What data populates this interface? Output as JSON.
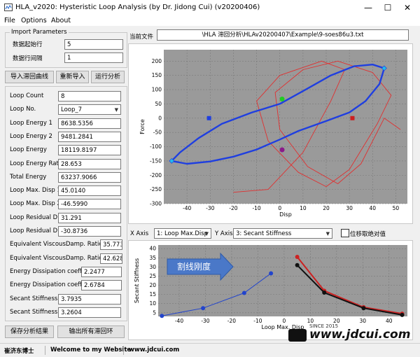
{
  "window": {
    "title": "HLA_v2020: Hysteristic Loop Analysis  (by Dr. Jidong Cui) (v20200406)",
    "minimize": "—",
    "maximize": "☐",
    "close": "✕"
  },
  "menu": {
    "file": "File",
    "options": "Options",
    "about": "About"
  },
  "import": {
    "title": "Import Parameters",
    "start_row_label": "数据起始行",
    "start_row_value": "5",
    "row_interval_label": "数据行间隔",
    "row_interval_value": "1"
  },
  "buttons": {
    "import_loop": "导入滞回曲线",
    "reimport": "重新导入",
    "run_analysis": "运行分析",
    "save_results": "保存分析结果",
    "export_loops": "输出所有滞回环"
  },
  "params": [
    {
      "label": "Loop Count",
      "value": "8"
    },
    {
      "label": "Loop No.",
      "value": "Loop_7"
    },
    {
      "label": "Loop Energy 1",
      "value": "8638.5356"
    },
    {
      "label": "Loop Energy 2",
      "value": "9481.2841"
    },
    {
      "label": "Loop Energy",
      "value": "18119.8197"
    },
    {
      "label": "Loop Energy Ratio (%)",
      "value": "28.653"
    },
    {
      "label": "Total Energy",
      "value": "63237.9066"
    },
    {
      "label": "Loop Max. Disp 1",
      "value": "45.0140"
    },
    {
      "label": "Loop Max. Disp 2",
      "value": "-46.5990"
    },
    {
      "label": "Loop Residual Disp1",
      "value": "31.291"
    },
    {
      "label": "Loop Residual Disp2",
      "value": "-30.8736"
    },
    {
      "label": "Equivalent ViscousDamp. Ratio1 (%)",
      "value": "35.773"
    },
    {
      "label": "Equivalent ViscousDamp. Ratio2 (%)",
      "value": "42.628"
    },
    {
      "label": "Energy Dissipation coeff. 1",
      "value": "2.2477"
    },
    {
      "label": "Energy Dissipation coeff. 2",
      "value": "2.6784"
    },
    {
      "label": "Secant Stiffness 1",
      "value": "3.7935"
    },
    {
      "label": "Secant Stiffness 2",
      "value": "3.2604"
    }
  ],
  "file": {
    "label": "当前文件",
    "path": "\\HLA 滞回分析\\HLAv20200407\\Example\\9-soes86u3.txt"
  },
  "axis_controls": {
    "x_label": "X Axis",
    "x_value": "1: Loop Max.Disp",
    "y_label": "Y Axis",
    "y_value": "3: Secant Stiffness",
    "checkbox_label": "位移取绝对值"
  },
  "chart_data": [
    {
      "type": "line",
      "xlabel": "Disp",
      "ylabel": "Force",
      "xlim": [
        -50,
        55
      ],
      "ylim": [
        -300,
        240
      ],
      "xticks": [
        -40,
        -30,
        -20,
        -10,
        0,
        10,
        20,
        30,
        40,
        50
      ],
      "yticks": [
        -300,
        -250,
        -200,
        -150,
        -100,
        -50,
        0,
        50,
        100,
        150,
        200
      ],
      "grid": true,
      "series": [
        {
          "role": "all loops",
          "color": "#e03030",
          "points": [
            [
              -20,
              -260
            ],
            [
              -5,
              -250
            ],
            [
              10,
              -120
            ],
            [
              22,
              60
            ],
            [
              28,
              170
            ],
            [
              18,
              200
            ],
            [
              0,
              150
            ],
            [
              -10,
              60
            ],
            [
              -5,
              -80
            ],
            [
              8,
              -190
            ],
            [
              20,
              -240
            ],
            [
              30,
              -180
            ],
            [
              42,
              -20
            ],
            [
              48,
              80
            ],
            [
              40,
              160
            ],
            [
              25,
              200
            ],
            [
              10,
              170
            ],
            [
              -2,
              90
            ],
            [
              0,
              -40
            ],
            [
              12,
              -170
            ],
            [
              25,
              -230
            ],
            [
              35,
              -160
            ],
            [
              45,
              0
            ],
            [
              52,
              -40
            ]
          ]
        },
        {
          "role": "selected loop",
          "color": "#1f3fe0",
          "points": [
            [
              -46.6,
              -150
            ],
            [
              -43,
              -120
            ],
            [
              -35,
              -70
            ],
            [
              -25,
              -20
            ],
            [
              -12,
              20
            ],
            [
              0,
              50
            ],
            [
              10,
              95
            ],
            [
              22,
              150
            ],
            [
              32,
              182
            ],
            [
              40,
              188
            ],
            [
              45,
              175
            ],
            [
              43,
              120
            ],
            [
              37,
              60
            ],
            [
              30,
              20
            ],
            [
              20,
              -10
            ],
            [
              8,
              -45
            ],
            [
              0,
              -75
            ],
            [
              -10,
              -110
            ],
            [
              -20,
              -135
            ],
            [
              -30,
              -152
            ],
            [
              -40,
              -160
            ],
            [
              -46.6,
              -150
            ]
          ]
        }
      ],
      "markers": [
        {
          "x": -30.5,
          "y": 0,
          "color": "#1f3fe0",
          "shape": "square"
        },
        {
          "x": 1,
          "y": 67,
          "color": "#22cc22",
          "shape": "circle"
        },
        {
          "x": 1,
          "y": -111,
          "color": "#8a1a8a",
          "shape": "circle"
        },
        {
          "x": 31.3,
          "y": 0,
          "color": "#cc2020",
          "shape": "square"
        },
        {
          "x": 45.0,
          "y": 175,
          "color": "#22bbee",
          "shape": "diamond"
        },
        {
          "x": -46.6,
          "y": -150,
          "color": "#22bbee",
          "shape": "diamond"
        }
      ]
    },
    {
      "type": "line",
      "xlabel": "Loop Max. Disp",
      "ylabel": "Secant Stiffness",
      "xlim": [
        -48,
        47
      ],
      "ylim": [
        3,
        42
      ],
      "xticks": [
        -40,
        -30,
        -20,
        -10,
        0,
        10,
        20,
        30,
        40
      ],
      "yticks": [
        5,
        10,
        15,
        20,
        25,
        30,
        35,
        40
      ],
      "grid": true,
      "annotation": "割线刚度",
      "series": [
        {
          "name": "negative",
          "color": "#2244cc",
          "x": [
            -46.6,
            -30.9,
            -15.2,
            -5.0
          ],
          "y": [
            3.3,
            7.5,
            15.8,
            26.5
          ]
        },
        {
          "name": "positive-red",
          "color": "#cc2222",
          "x": [
            5.0,
            15.3,
            30.3,
            45.0
          ],
          "y": [
            35.5,
            17.0,
            8.0,
            4.5
          ]
        },
        {
          "name": "positive-black",
          "color": "#111111",
          "x": [
            5.0,
            15.3,
            30.3,
            45.0
          ],
          "y": [
            31.0,
            16.0,
            7.5,
            3.8
          ]
        }
      ]
    }
  ],
  "status": {
    "author": "崔济东博士",
    "welcome": "Welcome to my Website",
    "url": "www.jdcui.com"
  },
  "watermark": {
    "brand": "www.jdcui.com",
    "since": "SINCE 2015"
  }
}
